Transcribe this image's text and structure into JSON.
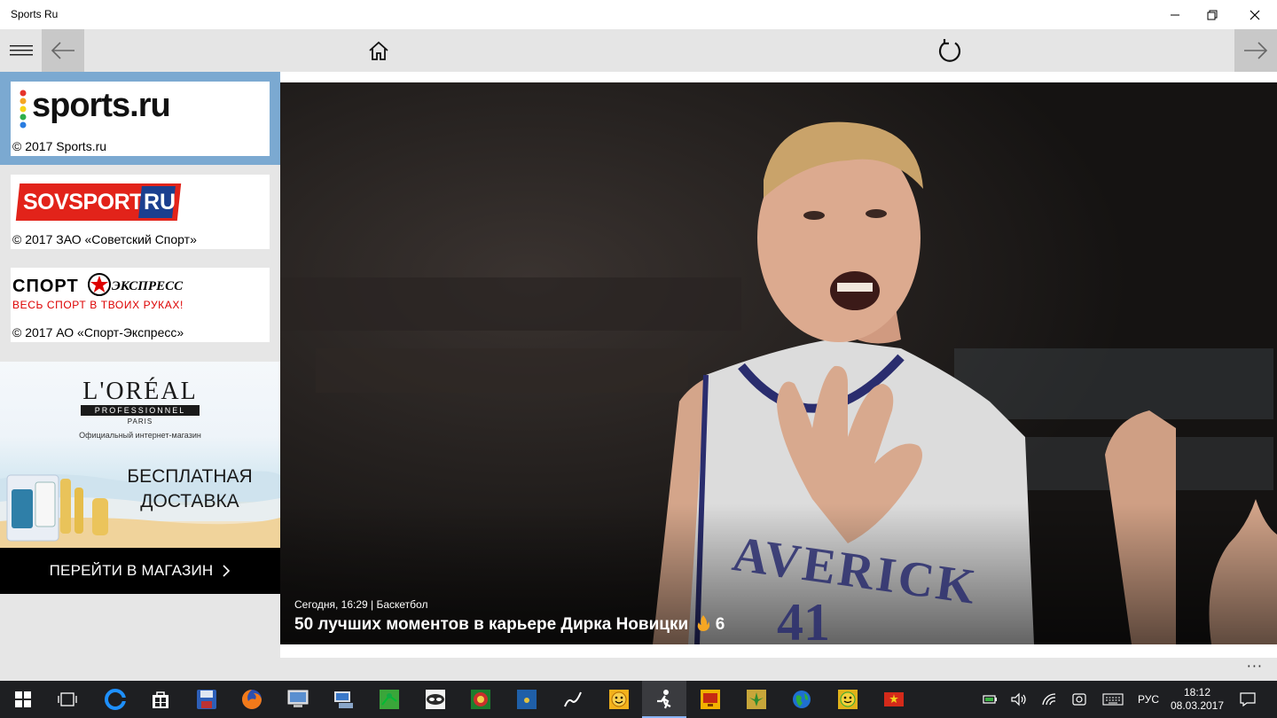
{
  "window": {
    "title": "Sports Ru",
    "minimize": "—",
    "restore": "❐",
    "close": "✕"
  },
  "toolbar": {
    "menu_icon": "hamburger-icon",
    "back_icon": "arrow-left-icon",
    "home_icon": "home-icon",
    "refresh_icon": "refresh-icon",
    "forward_icon": "arrow-right-icon"
  },
  "sources": [
    {
      "logo_text": "sports.ru",
      "copyright": "© 2017 Sports.ru",
      "selected": true
    },
    {
      "logo_text": "SOVSPORT",
      "logo_suffix": "RU",
      "copyright": "© 2017 ЗАО «Советский Спорт»",
      "selected": false
    },
    {
      "logo_text_left": "СПОРТ",
      "logo_text_right": "ЭКСПРЕСС",
      "logo_tagline": "ВЕСЬ СПОРТ В ТВОИХ РУКАХ!",
      "copyright": "© 2017 АО «Спорт-Экспресс»",
      "selected": false
    }
  ],
  "ad": {
    "brand": "L'ORÉAL",
    "brand_sub": "PROFESSIONNEL",
    "brand_city": "PARIS",
    "shop_label": "Официальный интернет-магазин",
    "offer_line1": "БЕСПЛАТНАЯ",
    "offer_line2": "ДОСТАВКА",
    "cta": "ПЕРЕЙТИ В МАГАЗИН",
    "cta_icon": "chevron-right-icon"
  },
  "article": {
    "meta": "Сегодня, 16:29  |  Баскетбол",
    "headline": "50 лучших моментов в карьере Дирка Новицки",
    "hot_icon": "flame-icon",
    "hot_count": "6",
    "jersey_text": "AVERICK",
    "jersey_number": "41"
  },
  "appbar": {
    "more": "···"
  },
  "taskbar": {
    "start_icon": "windows-start-icon",
    "taskview_icon": "task-view-icon",
    "apps": [
      "edge-icon",
      "store-icon",
      "save-app-icon",
      "firefox-icon",
      "computer-icon",
      "network-app-icon",
      "green-app-icon",
      "mask-app-icon",
      "chess-app-icon",
      "blue-app-icon",
      "pen-app-icon",
      "emoji-app-icon",
      "runner-app-icon",
      "monitor-app-icon",
      "leaf-app-icon",
      "globe-app-icon",
      "smiley-app-icon",
      "flag-app-icon"
    ],
    "tray_icons": [
      "battery-icon",
      "volume-icon",
      "wifi-icon",
      "network-tray-icon",
      "keyboard-icon"
    ],
    "language": "РУС",
    "time": "18:12",
    "date": "08.03.2017",
    "notifications_icon": "notifications-icon"
  },
  "colors": {
    "selected_source": "#7ba9d1",
    "toolbar": "#e5e5e5",
    "taskbar": "#1e1f22",
    "sovsport_red": "#e2231a"
  }
}
